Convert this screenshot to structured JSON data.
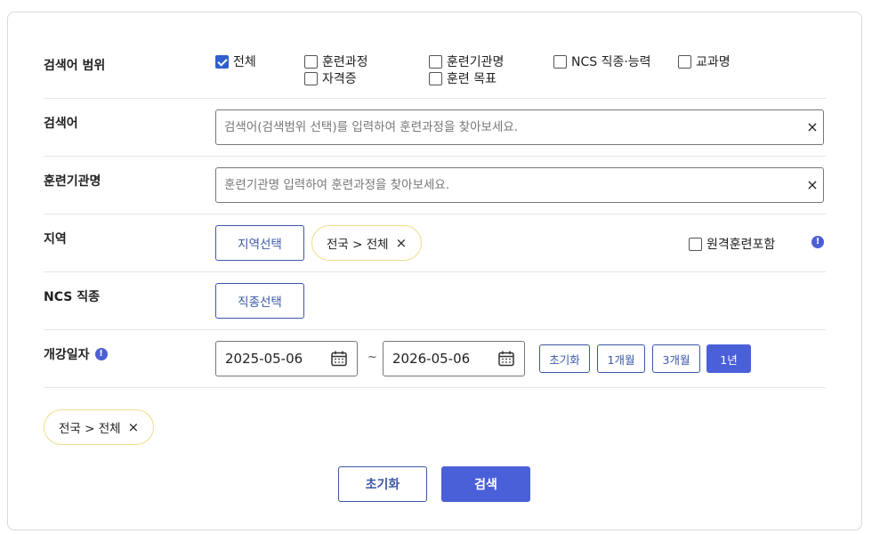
{
  "scope": {
    "label": "검색어 범위",
    "options": [
      {
        "label": "전체",
        "checked": true
      },
      {
        "label": "훈련과정",
        "checked": false
      },
      {
        "label": "훈련기관명",
        "checked": false
      },
      {
        "label": "NCS 직종·능력",
        "checked": false
      },
      {
        "label": "교과명",
        "checked": false
      },
      {
        "label": "자격증",
        "checked": false
      },
      {
        "label": "훈련 목표",
        "checked": false
      }
    ]
  },
  "keyword": {
    "label": "검색어",
    "value": "",
    "placeholder": "검색어(검색범위 선택)를 입력하여 훈련과정을 찾아보세요."
  },
  "institution": {
    "label": "훈련기관명",
    "value": "",
    "placeholder": "훈련기관명 입력하여 훈련과정을 찾아보세요."
  },
  "region": {
    "label": "지역",
    "select_button": "지역선택",
    "chip": "전국 > 전체",
    "remote_label": "원격훈련포함",
    "remote_checked": false
  },
  "ncs": {
    "label": "NCS 직종",
    "select_button": "직종선택"
  },
  "period": {
    "label": "개강일자",
    "start": "2025-05-06",
    "separator": "~",
    "end": "2026-05-06",
    "buttons": [
      {
        "label": "초기화",
        "active": false
      },
      {
        "label": "1개월",
        "active": false
      },
      {
        "label": "3개월",
        "active": false
      },
      {
        "label": "1년",
        "active": true
      }
    ]
  },
  "selected_chip": "전국 > 전체",
  "actions": {
    "reset": "초기화",
    "search": "검색"
  },
  "icons": {
    "clear": "close-icon",
    "info": "info-icon",
    "calendar": "calendar-icon"
  },
  "colors": {
    "primary": "#4a60d9",
    "outline": "#3b57a6",
    "chip_border": "#f0dc8a"
  }
}
